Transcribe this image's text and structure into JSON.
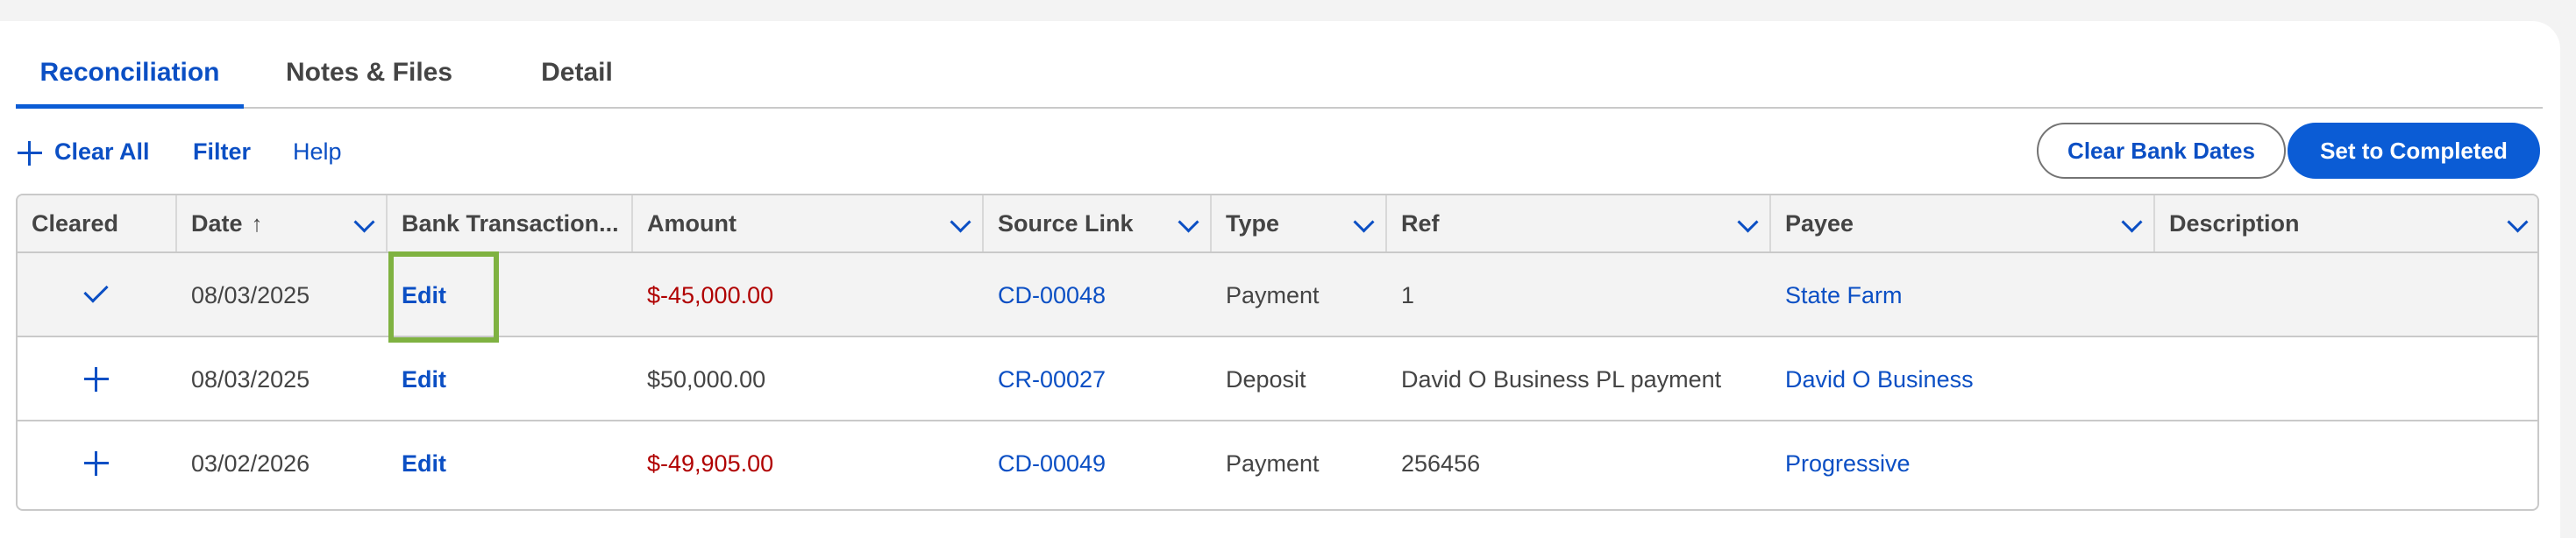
{
  "tabs": [
    {
      "label": "Reconciliation",
      "active": true
    },
    {
      "label": "Notes & Files",
      "active": false
    },
    {
      "label": "Detail",
      "active": false
    }
  ],
  "toolbar": {
    "clear_all": "Clear All",
    "filter": "Filter",
    "help": "Help",
    "clear_bank_dates": "Clear Bank Dates",
    "set_to_completed": "Set to Completed"
  },
  "table": {
    "columns": [
      "Cleared",
      "Date",
      "Bank Transaction...",
      "Amount",
      "Source Link",
      "Type",
      "Ref",
      "Payee",
      "Description"
    ],
    "sort_icon": "arrow-up-icon",
    "rows": [
      {
        "cleared_icon": "check-icon",
        "date": "08/03/2025",
        "bank_transaction": "Edit",
        "amount": "$-45,000.00",
        "source_link": "CD-00048",
        "type": "Payment",
        "ref": "1",
        "payee": "State Farm",
        "description": ""
      },
      {
        "cleared_icon": "plus-icon",
        "date": "08/03/2025",
        "bank_transaction": "Edit",
        "amount": "$50,000.00",
        "source_link": "CR-00027",
        "type": "Deposit",
        "ref": "David O Business PL payment",
        "payee": "David O Business",
        "description": ""
      },
      {
        "cleared_icon": "plus-icon",
        "date": "03/02/2026",
        "bank_transaction": "Edit",
        "amount": "$-49,905.00",
        "source_link": "CD-00049",
        "type": "Payment",
        "ref": "256456",
        "payee": "Progressive",
        "description": ""
      }
    ]
  },
  "colors": {
    "accent": "#0b5cd5",
    "link": "#0b4fc4",
    "negative_amount": "#b00000",
    "focus_highlight": "#7fb241"
  }
}
